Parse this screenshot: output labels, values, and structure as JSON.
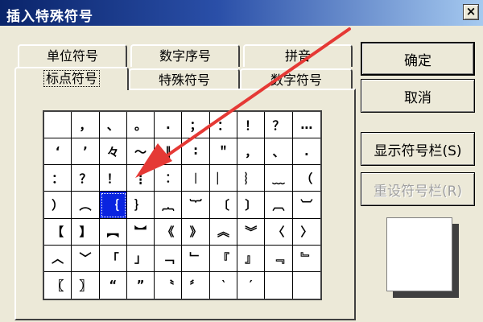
{
  "window": {
    "title": "插入特殊符号",
    "close_glyph": "×"
  },
  "tabs": {
    "row_back": [
      "单位符号",
      "数字序号",
      "拼音"
    ],
    "row_front": [
      "标点符号",
      "特殊符号",
      "数字符号"
    ],
    "active": "标点符号"
  },
  "symbols": [
    [
      "",
      "，",
      "、",
      "。",
      ".",
      "；",
      "：",
      "！",
      "？",
      "…"
    ],
    [
      "‘",
      "’",
      "々",
      "～",
      "‖",
      "∶",
      "＂",
      "，",
      "、",
      "."
    ],
    [
      "：",
      "？",
      "！",
      "┋",
      "︰",
      "︱",
      "︳",
      "︴",
      "﹏",
      "（"
    ],
    [
      "）",
      "︵",
      "｛",
      "｝",
      "︷",
      "︸",
      "〔",
      "〕",
      "︹",
      "︺"
    ],
    [
      "【",
      "】",
      "︻",
      "︼",
      "《",
      "》",
      "︽",
      "︾",
      "〈",
      "〉"
    ],
    [
      "︿",
      "﹀",
      "「",
      "」",
      "﹁",
      "﹂",
      "『",
      "』",
      "﹃",
      "﹄"
    ],
    [
      "〖",
      "〗",
      "“",
      "”",
      "〝",
      "〞",
      "‵",
      "′",
      "",
      ""
    ]
  ],
  "selected_symbol": "｛",
  "buttons": {
    "ok": "确定",
    "cancel": "取消",
    "show_bar": "显示符号栏(S)",
    "reset_bar": "重设符号栏(R)"
  },
  "annotation": {
    "arrow_color": "#E53935"
  }
}
